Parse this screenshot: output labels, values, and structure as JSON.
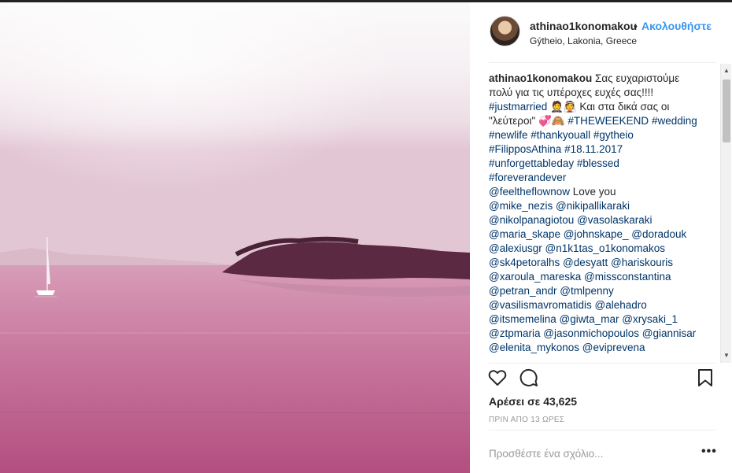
{
  "post": {
    "username": "athinao1konomakou",
    "separator": "•",
    "follow_label": "Ακολουθήστε",
    "location": "Gýtheio, Lakonia, Greece"
  },
  "caption": {
    "lines": [
      [
        {
          "t": "athinao1konomakou",
          "c": "u"
        },
        {
          "t": " Σας ευχαριστούμε",
          "c": ""
        }
      ],
      [
        {
          "t": "πολύ για τις υπέροχες ευχές σας!!!!",
          "c": ""
        }
      ],
      [
        {
          "t": "#justmarried",
          "c": "tag"
        },
        {
          "t": " 🤵👰 Και στα δικά σας οι",
          "c": ""
        }
      ],
      [
        {
          "t": "\"λεύτεροι\" 💞🙈 ",
          "c": ""
        },
        {
          "t": "#THEWEEKEND",
          "c": "tag"
        },
        {
          "t": " ",
          "c": ""
        },
        {
          "t": "#wedding",
          "c": "tag"
        }
      ],
      [
        {
          "t": "#newlife",
          "c": "tag"
        },
        {
          "t": " ",
          "c": ""
        },
        {
          "t": "#thankyouall",
          "c": "tag"
        },
        {
          "t": " ",
          "c": ""
        },
        {
          "t": "#gytheio",
          "c": "tag"
        }
      ],
      [
        {
          "t": "#FilipposAthina",
          "c": "tag"
        },
        {
          "t": " ",
          "c": ""
        },
        {
          "t": "#18.11.2017",
          "c": "tag"
        }
      ],
      [
        {
          "t": "#unforgettableday",
          "c": "tag"
        },
        {
          "t": " ",
          "c": ""
        },
        {
          "t": "#blessed",
          "c": "tag"
        }
      ],
      [
        {
          "t": "#foreverandever",
          "c": "tag"
        }
      ],
      [
        {
          "t": "@feeltheflownow",
          "c": "tag"
        },
        {
          "t": " Love you",
          "c": ""
        }
      ],
      [
        {
          "t": "@mike_nezis",
          "c": "tag"
        },
        {
          "t": " ",
          "c": ""
        },
        {
          "t": "@nikipallikaraki",
          "c": "tag"
        }
      ],
      [
        {
          "t": "@nikolpanagiotou",
          "c": "tag"
        },
        {
          "t": " ",
          "c": ""
        },
        {
          "t": "@vasolaskaraki",
          "c": "tag"
        }
      ],
      [
        {
          "t": "@maria_skape",
          "c": "tag"
        },
        {
          "t": " ",
          "c": ""
        },
        {
          "t": "@johnskape_",
          "c": "tag"
        },
        {
          "t": " ",
          "c": ""
        },
        {
          "t": "@doradouk",
          "c": "tag"
        }
      ],
      [
        {
          "t": "@alexiusgr",
          "c": "tag"
        },
        {
          "t": " ",
          "c": ""
        },
        {
          "t": "@n1k1tas_o1konomakos",
          "c": "tag"
        }
      ],
      [
        {
          "t": "@sk4petoralhs",
          "c": "tag"
        },
        {
          "t": " ",
          "c": ""
        },
        {
          "t": "@desyatt",
          "c": "tag"
        },
        {
          "t": " ",
          "c": ""
        },
        {
          "t": "@hariskouris",
          "c": "tag"
        }
      ],
      [
        {
          "t": "@xaroula_mareska",
          "c": "tag"
        },
        {
          "t": " ",
          "c": ""
        },
        {
          "t": "@missconstantina",
          "c": "tag"
        }
      ],
      [
        {
          "t": "@petran_andr",
          "c": "tag"
        },
        {
          "t": " ",
          "c": ""
        },
        {
          "t": "@tmlpenny",
          "c": "tag"
        }
      ],
      [
        {
          "t": "@vasilismavromatidis",
          "c": "tag"
        },
        {
          "t": " ",
          "c": ""
        },
        {
          "t": "@alehadro",
          "c": "tag"
        }
      ],
      [
        {
          "t": "@itsmemelina",
          "c": "tag"
        },
        {
          "t": " ",
          "c": ""
        },
        {
          "t": "@giwta_mar",
          "c": "tag"
        },
        {
          "t": " ",
          "c": ""
        },
        {
          "t": "@xrysaki_1",
          "c": "tag"
        }
      ],
      [
        {
          "t": "@ztpmaria",
          "c": "tag"
        },
        {
          "t": " ",
          "c": ""
        },
        {
          "t": "@jasonmichopoulos",
          "c": "tag"
        },
        {
          "t": " ",
          "c": ""
        },
        {
          "t": "@giannisar",
          "c": "tag"
        }
      ],
      [
        {
          "t": "@elenita_mykonos",
          "c": "tag"
        },
        {
          "t": " ",
          "c": ""
        },
        {
          "t": "@eviprevena",
          "c": "tag"
        }
      ]
    ]
  },
  "actions": {
    "like_icon": "heart-outline-icon",
    "comment_icon": "comment-bubble-icon",
    "save_icon": "bookmark-icon"
  },
  "likes_text": "Αρέσει σε 43,625",
  "time_ago": "ΠΡΙΝ ΑΠΟ 13 ΩΡΕΣ",
  "comment_box": {
    "placeholder": "Προσθέστε ένα σχόλιο...",
    "more_label": "•••"
  },
  "colors": {
    "link_blue": "#3897f0",
    "hashtag": "#003569",
    "photo_tint": "#b04a78"
  }
}
